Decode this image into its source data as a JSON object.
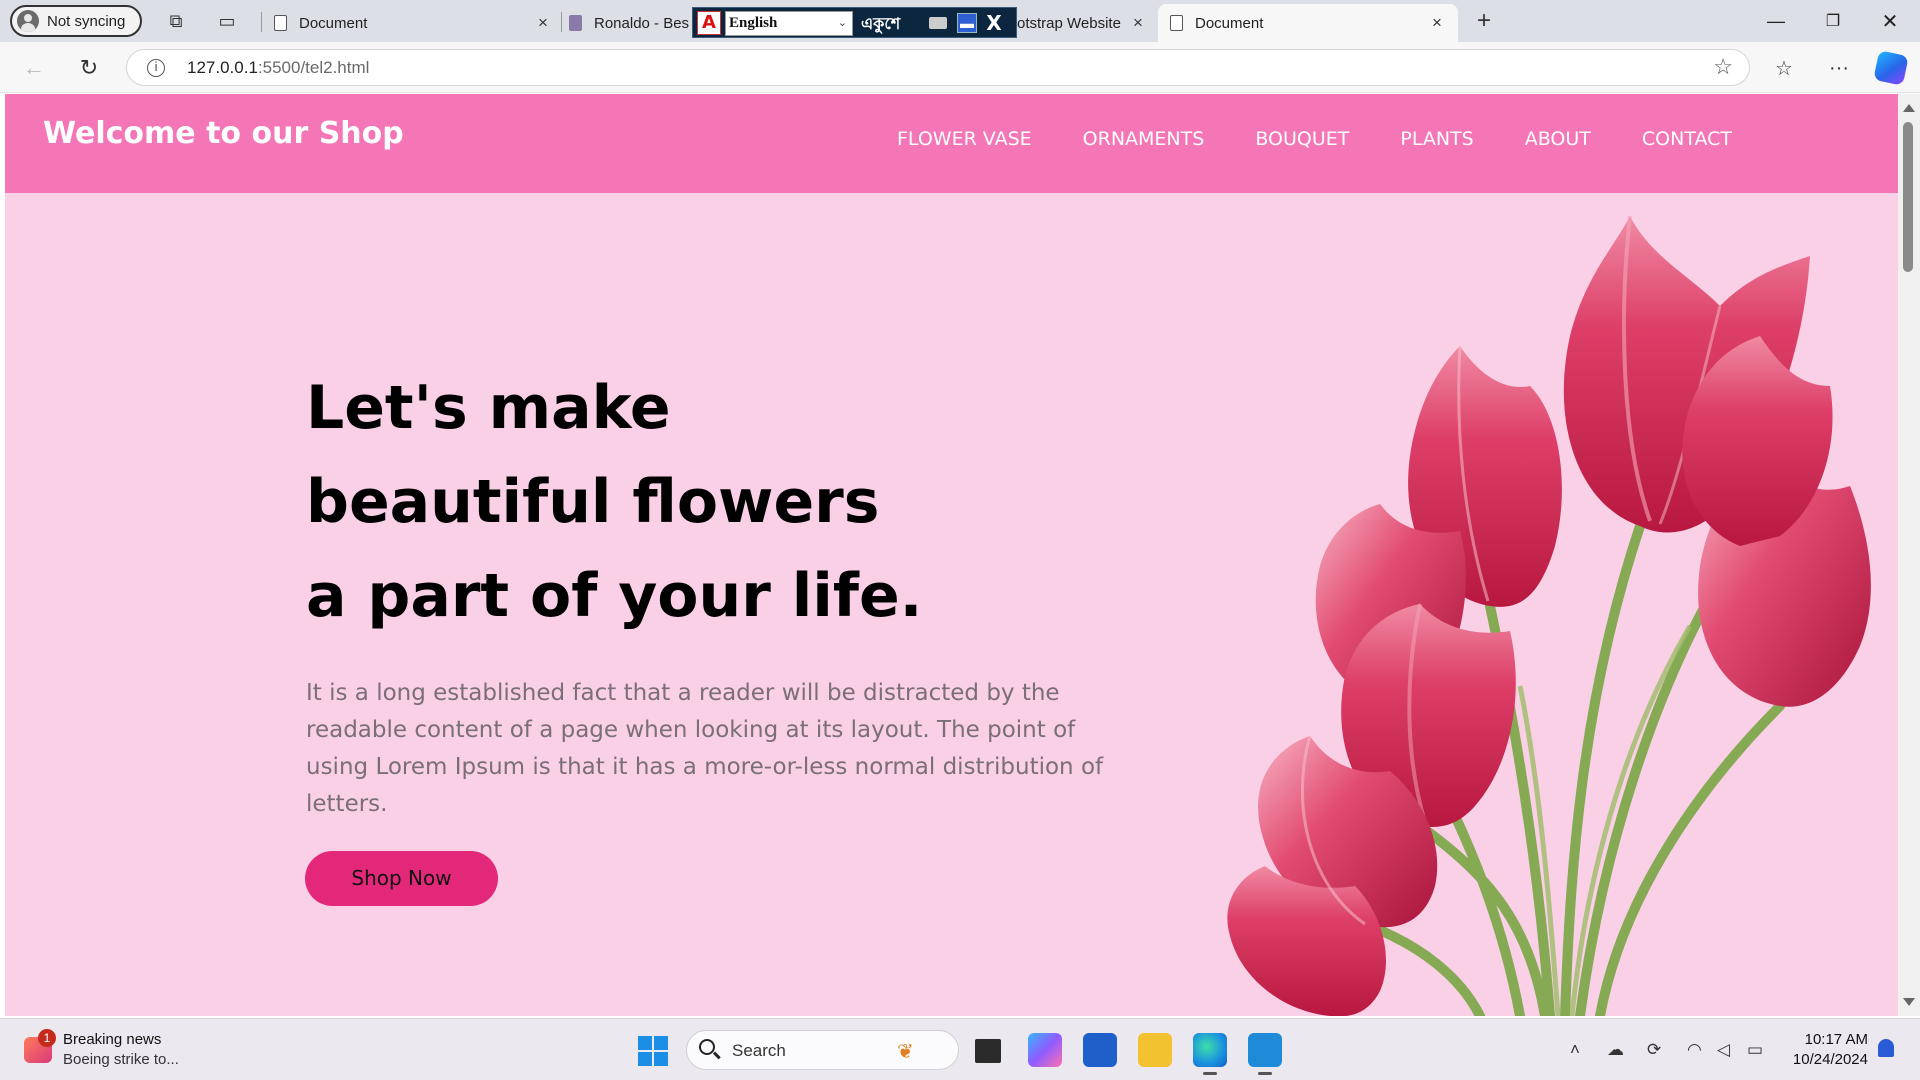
{
  "browser": {
    "profile_label": "Not syncing",
    "tabs": [
      {
        "title": "Document",
        "close": "×"
      },
      {
        "title": "Ronaldo - Bes",
        "close": ""
      },
      {
        "title": "otstrap Website",
        "close": "×"
      },
      {
        "title": "Document",
        "close": "×",
        "active": true
      }
    ],
    "new_tab": "+",
    "url_host": "127.0.0.1",
    "url_path": ":5500/tel2.html"
  },
  "ime_overlay": {
    "language": "English",
    "script_text": "একুশে"
  },
  "page": {
    "brand": "Welcome to our Shop",
    "menu": [
      "FLOWER VASE",
      "ORNAMENTS",
      "BOUQUET",
      "PLANTS",
      "ABOUT",
      "CONTACT"
    ],
    "headline": "Let's make beautiful flowers a part of your life.",
    "description": "It is a long established fact that a reader will be distracted by the readable content of a page when looking at its layout. The point of using Lorem Ipsum is that it has a more-or-less normal distribution of letters.",
    "cta": "Shop Now"
  },
  "taskbar": {
    "news_title": "Breaking news",
    "news_subtitle": "Boeing strike to...",
    "news_badge": "1",
    "search_placeholder": "Search",
    "time": "10:17 AM",
    "date": "10/24/2024"
  },
  "colors": {
    "navbar": "#f476b7",
    "hero_bg": "#fad0e7",
    "cta_bg": "#e3287a",
    "tulip": "#d93a66",
    "stem": "#7aa14a"
  }
}
